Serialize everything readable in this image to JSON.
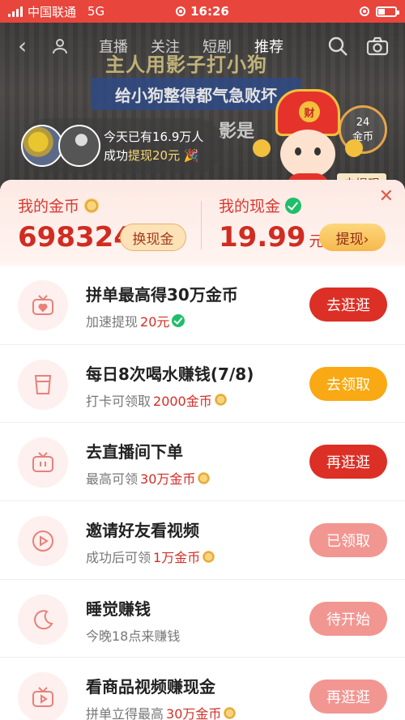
{
  "status_bar": {
    "carrier": "中国联通",
    "network": "5G",
    "time": "16:26"
  },
  "video": {
    "nav_tabs": [
      "直播",
      "关注",
      "短剧",
      "推荐"
    ],
    "title": "主人用影子打小狗",
    "banner": "给小狗整得都气急败坏",
    "sub": "影是",
    "badge_lines": [
      "24",
      "金币"
    ],
    "withdraw_tag": "去提现"
  },
  "bubble": {
    "line1": "今天已有16.9万人",
    "line2_prefix": "成功",
    "line2_highlight": "提现20元",
    "line2_suffix": "🎉"
  },
  "mascot": {
    "badge": "财"
  },
  "wallet": {
    "coin_label": "我的金币",
    "coin_value": "698324",
    "exchange_btn": "换现金",
    "cash_label": "我的现金",
    "cash_value": "19.99",
    "cash_unit": "元",
    "withdraw_btn": "提现›",
    "close": "✕"
  },
  "tasks": [
    {
      "title": "拼单最高得30万金币",
      "sub_prefix": "加速提现",
      "sub_red": "20元",
      "sub_suffix": "",
      "button": "去逛逛",
      "icon": "tv-heart-icon",
      "sub_icon": "check"
    },
    {
      "title": "每日8次喝水赚钱(7/8)",
      "sub_prefix": "打卡可领取",
      "sub_red": "2000金币",
      "sub_suffix": "",
      "button": "去领取",
      "icon": "cup-icon",
      "sub_icon": "coin"
    },
    {
      "title": "去直播间下单",
      "sub_prefix": "最高可领",
      "sub_red": "30万金币",
      "sub_suffix": "",
      "button": "再逛逛",
      "icon": "tv-icon",
      "sub_icon": "coin"
    },
    {
      "title": "邀请好友看视频",
      "sub_prefix": "成功后可领",
      "sub_red": "1万金币",
      "sub_suffix": "",
      "button": "已领取",
      "icon": "play-icon",
      "sub_icon": "coin"
    },
    {
      "title": "睡觉赚钱",
      "sub_prefix": "今晚18点来赚钱",
      "sub_red": "",
      "sub_suffix": "",
      "button": "待开始",
      "icon": "moon-icon",
      "sub_icon": ""
    },
    {
      "title": "看商品视频赚现金",
      "sub_prefix": "拼单立得最高",
      "sub_red": "30万金币",
      "sub_suffix": "",
      "button": "再逛逛",
      "icon": "video-play-icon",
      "sub_icon": "coin"
    }
  ],
  "colors": {
    "status_bar": "#e8453c",
    "primary_red": "#dc2f25",
    "orange": "#f9a913",
    "pink_disabled": "#f29692"
  }
}
